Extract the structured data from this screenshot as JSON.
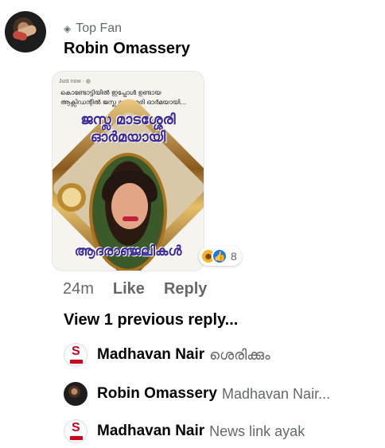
{
  "comment": {
    "badge": "Top Fan",
    "badge_icon": "diamond-icon",
    "author": "Robin Omassery",
    "image": {
      "header": "Just now · ",
      "line1": "കൊണ്ടോട്ടിയിൽ ഇപ്പോൾ ഉണ്ടായ",
      "line2": "ആക്സിഡന്റിൽ ജസ്ല മാടശ്ശേരി ഓർമയായി...",
      "title1": "ജസ്ല മാടശ്ശേരി",
      "title2": "ഓർമയായി",
      "title3": "ആദരാഞ്ജലികൾ"
    },
    "reactions": {
      "count": "8",
      "types": [
        "haha",
        "like"
      ]
    },
    "time": "24m",
    "like_label": "Like",
    "reply_label": "Reply"
  },
  "view_previous": "View 1 previous reply...",
  "replies": [
    {
      "name": "Madhavan Nair",
      "text": "ശെരിക്കും",
      "avatar": "logo"
    },
    {
      "name": "Robin Omassery",
      "text": "Madhavan Nair...",
      "avatar": "robin"
    },
    {
      "name": "Madhavan Nair",
      "text": "News link ayak",
      "avatar": "logo"
    }
  ],
  "colors": {
    "secondary_text": "#65676b",
    "like_blue": "#1877f2",
    "haha_yellow": "#f7b125"
  }
}
